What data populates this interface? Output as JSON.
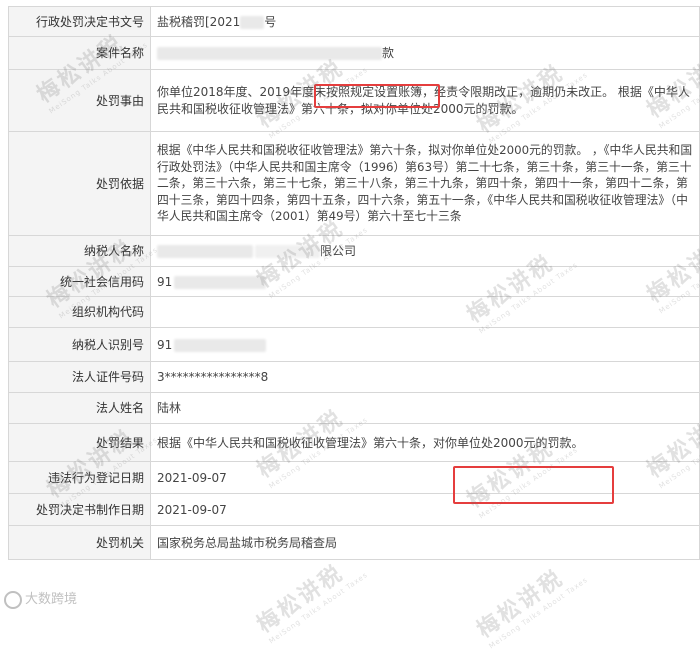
{
  "rows": [
    {
      "label": "行政处罚决定书文号",
      "value": "盐税稽罚[2021",
      "suffix": "号"
    },
    {
      "label": "案件名称",
      "value": "",
      "suffix": "款"
    },
    {
      "label": "处罚事由",
      "value": "你单位2018年度、2019年度未按照规定设置账簿，经责令限期改正，逾期仍未改正。 根据《中华人民共和国税收征收管理法》第六十条，拟对你单位处2000元的罚款。"
    },
    {
      "label": "处罚依据",
      "value": "根据《中华人民共和国税收征收管理法》第六十条，拟对你单位处2000元的罚款。 ，《中华人民共和国行政处罚法》（中华人民共和国主席令（1996）第63号）第二十七条，第三十条，第三十一条，第三十二条，第三十六条，第三十七条，第三十八条，第三十九条，第四十条，第四十一条，第四十二条，第四十三条，第四十四条，第四十五条，四十六条，第五十一条，《中华人民共和国税收征收管理法》（中华人民共和国主席令（2001）第49号）第六十至七十三条"
    },
    {
      "label": "纳税人名称",
      "value": "",
      "suffix": "限公司"
    },
    {
      "label": "统一社会信用码",
      "value": "91"
    },
    {
      "label": "组织机构代码",
      "value": ""
    },
    {
      "label": "纳税人识别号",
      "value": "91"
    },
    {
      "label": "法人证件号码",
      "value": "3****************8"
    },
    {
      "label": "法人姓名",
      "value": "陆林"
    },
    {
      "label": "处罚结果",
      "value": "根据《中华人民共和国税收征收管理法》第六十条，对你单位处2000元的罚款。"
    },
    {
      "label": "违法行为登记日期",
      "value": "2021-09-07"
    },
    {
      "label": "处罚决定书制作日期",
      "value": "2021-09-07"
    },
    {
      "label": "处罚机关",
      "value": "国家税务总局盐城市税务局稽查局"
    }
  ],
  "watermark": {
    "text": "梅松讲税",
    "sub": "MeiSong Talks About Taxes"
  },
  "logo_text": "大数跨境"
}
